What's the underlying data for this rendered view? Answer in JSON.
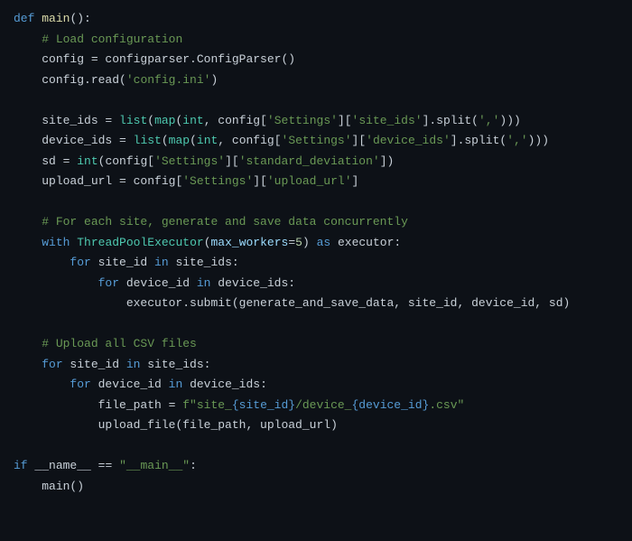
{
  "code": {
    "line1": {
      "kw1": "def",
      "fn": "main",
      "paren": "():"
    },
    "line2": {
      "indent": "    ",
      "comment": "# Load configuration"
    },
    "line3": {
      "indent": "    ",
      "var": "config = configparser.ConfigParser()"
    },
    "line4": {
      "indent": "    ",
      "pre": "config.read(",
      "str": "'config.ini'",
      "post": ")"
    },
    "line6": {
      "indent": "    ",
      "var1": "site_ids = ",
      "fn1": "list",
      "p1": "(",
      "fn2": "map",
      "p2": "(",
      "type": "int",
      "mid": ", config[",
      "str1": "'Settings'",
      "mid2": "][",
      "str2": "'site_ids'",
      "mid3": "].split(",
      "str3": "','",
      "post": ")))"
    },
    "line7": {
      "indent": "    ",
      "var1": "device_ids = ",
      "fn1": "list",
      "p1": "(",
      "fn2": "map",
      "p2": "(",
      "type": "int",
      "mid": ", config[",
      "str1": "'Settings'",
      "mid2": "][",
      "str2": "'device_ids'",
      "mid3": "].split(",
      "str3": "','",
      "post": ")))"
    },
    "line8": {
      "indent": "    ",
      "var1": "sd = ",
      "type": "int",
      "p1": "(config[",
      "str1": "'Settings'",
      "mid": "][",
      "str2": "'standard_deviation'",
      "post": "])"
    },
    "line9": {
      "indent": "    ",
      "var1": "upload_url = config[",
      "str1": "'Settings'",
      "mid": "][",
      "str2": "'upload_url'",
      "post": "]"
    },
    "line11": {
      "indent": "    ",
      "comment": "# For each site, generate and save data concurrently"
    },
    "line12": {
      "indent": "    ",
      "kw": "with",
      "sp": " ",
      "cls": "ThreadPoolExecutor",
      "p1": "(",
      "param": "max_workers",
      "eq": "=",
      "num": "5",
      "p2": ") ",
      "kw2": "as",
      "post": " executor:"
    },
    "line13": {
      "indent": "        ",
      "kw": "for",
      "var1": " site_id ",
      "kw2": "in",
      "post": " site_ids:"
    },
    "line14": {
      "indent": "            ",
      "kw": "for",
      "var1": " device_id ",
      "kw2": "in",
      "post": " device_ids:"
    },
    "line15": {
      "indent": "                ",
      "text": "executor.submit(generate_and_save_data, site_id, device_id, sd)"
    },
    "line17": {
      "indent": "    ",
      "comment": "# Upload all CSV files"
    },
    "line18": {
      "indent": "    ",
      "kw": "for",
      "var1": " site_id ",
      "kw2": "in",
      "post": " site_ids:"
    },
    "line19": {
      "indent": "        ",
      "kw": "for",
      "var1": " device_id ",
      "kw2": "in",
      "post": " device_ids:"
    },
    "line20": {
      "indent": "            ",
      "var1": "file_path = ",
      "fstr_pre": "f\"site_",
      "brace1": "{site_id}",
      "fstr_mid": "/device_",
      "brace2": "{device_id}",
      "fstr_post": ".csv\""
    },
    "line21": {
      "indent": "            ",
      "text": "upload_file(file_path, upload_url)"
    },
    "line23": {
      "kw": "if",
      "sp": " ",
      "dunder": "__name__",
      "eq": " == ",
      "str": "\"__main__\"",
      "colon": ":"
    },
    "line24": {
      "indent": "    ",
      "text": "main()"
    }
  }
}
